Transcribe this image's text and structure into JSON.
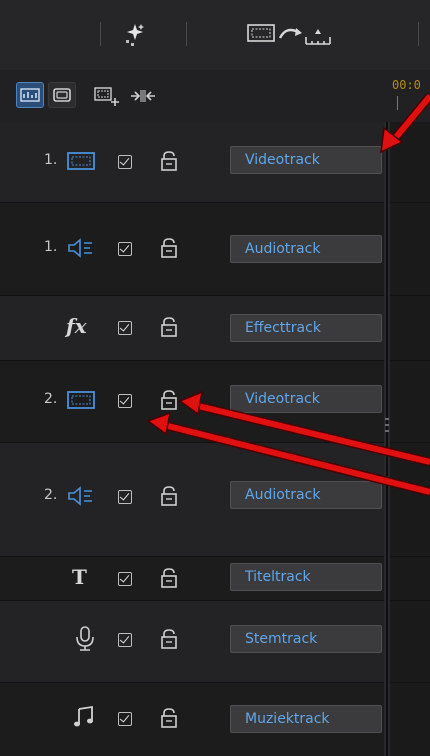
{
  "timeline": {
    "timecode": "00:0"
  },
  "tracks": [
    {
      "number": "1.",
      "type": "video",
      "icon": "video-track-icon",
      "name": "Videotrack",
      "enabled": true,
      "locked": false
    },
    {
      "number": "1.",
      "type": "audio",
      "icon": "audio-track-icon",
      "name": "Audiotrack",
      "enabled": true,
      "locked": false
    },
    {
      "number": "",
      "type": "effect",
      "icon": "fx-icon",
      "symbol": "fx",
      "name": "Effecttrack",
      "enabled": true,
      "locked": false
    },
    {
      "number": "2.",
      "type": "video",
      "icon": "video-track-icon",
      "name": "Videotrack",
      "enabled": true,
      "locked": false
    },
    {
      "number": "2.",
      "type": "audio",
      "icon": "audio-track-icon",
      "name": "Audiotrack",
      "enabled": true,
      "locked": false
    },
    {
      "number": "",
      "type": "title",
      "icon": "title-icon",
      "symbol": "T",
      "name": "Titeltrack",
      "enabled": true,
      "locked": false
    },
    {
      "number": "",
      "type": "voice",
      "icon": "microphone-icon",
      "name": "Stemtrack",
      "enabled": true,
      "locked": false
    },
    {
      "number": "",
      "type": "music",
      "icon": "music-note-icon",
      "name": "Muziektrack",
      "enabled": true,
      "locked": false
    }
  ],
  "colors": {
    "accent_blue": "#4a90d9",
    "track_label_text": "#5fa6ea",
    "annotation_red": "#e01010",
    "timecode": "#b58a1b"
  }
}
